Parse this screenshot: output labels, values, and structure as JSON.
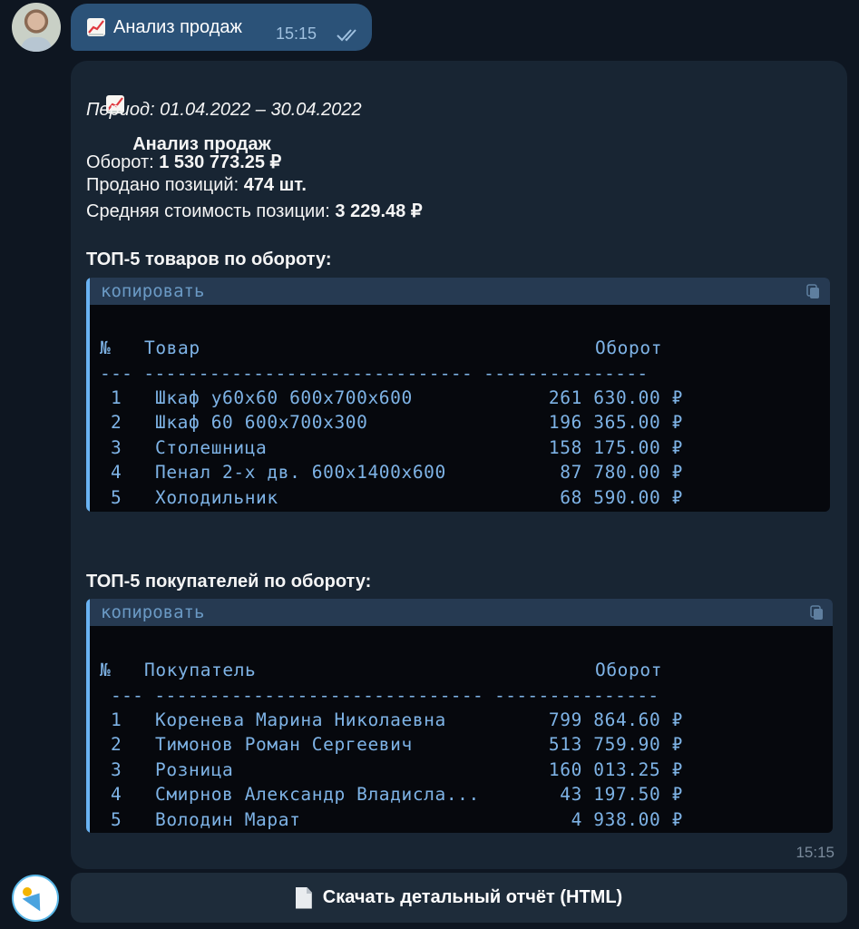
{
  "outgoing": {
    "text": "Анализ продаж",
    "time": "15:15",
    "icon": "chart-increasing-icon"
  },
  "report": {
    "title": "Анализ продаж",
    "period": "Период: 01.04.2022 – 30.04.2022",
    "turnover_label": "Оборот: ",
    "turnover_value": "1 530 773.25 ₽",
    "sold_label": "Продано позиций: ",
    "sold_value": "474 шт.",
    "avg_label": "Средняя стоимость позиции: ",
    "avg_value": "3 229.48 ₽",
    "time": "15:15"
  },
  "top_products": {
    "heading": "ТОП-5 товаров по обороту:",
    "copy_label": "копировать",
    "col_num": "№",
    "col_name": "Товар",
    "col_value": "Оборот",
    "separator": "--- ------------------------------ ---------------",
    "rows": [
      {
        "num": "1",
        "name": "Шкаф у60х60 600х700х600",
        "value": "261 630.00 ₽"
      },
      {
        "num": "2",
        "name": "Шкаф 60 600х700х300",
        "value": "196 365.00 ₽"
      },
      {
        "num": "3",
        "name": "Столешница",
        "value": "158 175.00 ₽"
      },
      {
        "num": "4",
        "name": "Пенал 2-х дв. 600х1400х600",
        "value": "87 780.00 ₽"
      },
      {
        "num": "5",
        "name": "Холодильник",
        "value": "68 590.00 ₽"
      }
    ]
  },
  "top_customers": {
    "heading": "ТОП-5 покупателей по обороту:",
    "copy_label": "копировать",
    "col_num": "№",
    "col_name": "Покупатель",
    "col_value": "Оборот",
    "separator": "--- ------------------------------ ---------------",
    "rows": [
      {
        "num": "1",
        "name": "Коренева Марина Николаевна",
        "value": "799 864.60 ₽"
      },
      {
        "num": "2",
        "name": "Тимонов Роман Сергеевич",
        "value": "513 759.90 ₽"
      },
      {
        "num": "3",
        "name": "Розница",
        "value": "160 013.25 ₽"
      },
      {
        "num": "4",
        "name": "Смирнов Александр Владисла...",
        "value": "43 197.50 ₽"
      },
      {
        "num": "5",
        "name": "Володин Марат",
        "value": "4 938.00 ₽"
      }
    ]
  },
  "download_button": {
    "label": "Скачать детальный отчёт (HTML)",
    "icon": "document-icon"
  },
  "colors": {
    "background": "#0e1621",
    "outgoing_bubble": "#2b5278",
    "incoming_bubble": "#182533",
    "code_text": "#7eb3e6",
    "accent": "#6ab3f3"
  }
}
